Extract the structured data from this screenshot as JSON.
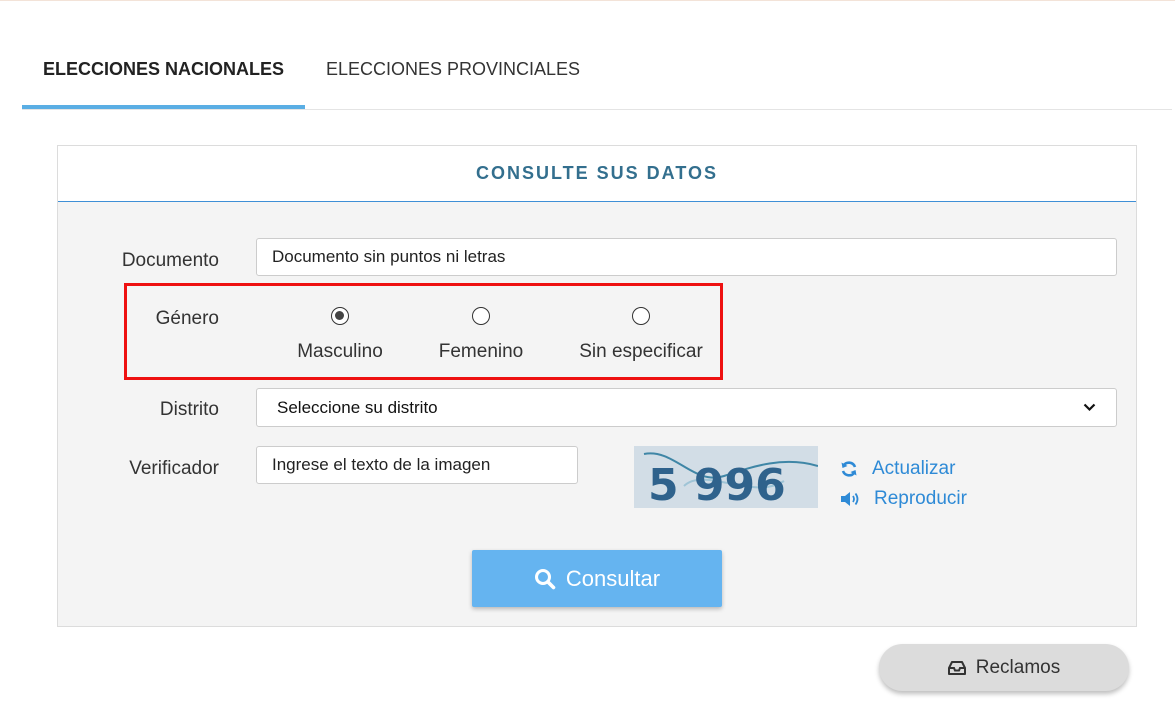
{
  "tabs": [
    {
      "label": "ELECCIONES NACIONALES",
      "active": true
    },
    {
      "label": "ELECCIONES PROVINCIALES",
      "active": false
    }
  ],
  "panel": {
    "title": "CONSULTE SUS DATOS"
  },
  "form": {
    "documento": {
      "label": "Documento",
      "placeholder": "Documento sin puntos ni letras"
    },
    "genero": {
      "label": "Género",
      "options": [
        {
          "label": "Masculino",
          "checked": true
        },
        {
          "label": "Femenino",
          "checked": false
        },
        {
          "label": "Sin especificar",
          "checked": false
        }
      ]
    },
    "distrito": {
      "label": "Distrito",
      "selected": "Seleccione su distrito"
    },
    "verificador": {
      "label": "Verificador",
      "placeholder": "Ingrese el texto de la imagen"
    }
  },
  "captcha": {
    "text": "5 996",
    "refresh_label": "Actualizar",
    "audio_label": "Reproducir",
    "refresh_icon": "refresh-icon",
    "audio_icon": "volume-icon"
  },
  "buttons": {
    "consultar": "Consultar",
    "reclamos": "Reclamos",
    "consultar_icon": "search-icon",
    "reclamos_icon": "inbox-icon"
  },
  "colors": {
    "accent": "#5aaee4",
    "title": "#336f8e",
    "highlight": "#ee1111",
    "link": "#2e8ad6",
    "primary_button": "#65b4f0"
  }
}
